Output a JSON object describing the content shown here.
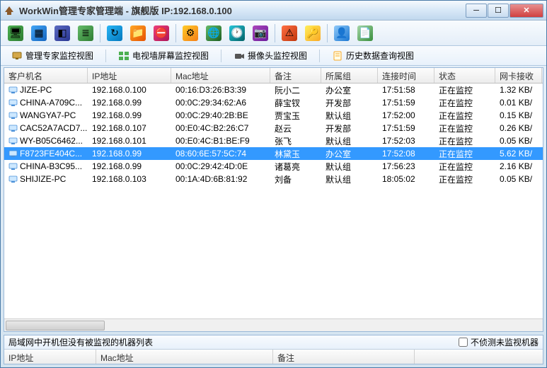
{
  "title": "WorkWin管理专家管理端 - 旗舰版 IP:192.168.0.100",
  "tabs": [
    {
      "label": "管理专家监控视图"
    },
    {
      "label": "电视墙屏幕监控视图"
    },
    {
      "label": "摄像头监控视图"
    },
    {
      "label": "历史数据查询视图"
    }
  ],
  "columns": {
    "client": "客户机名",
    "ip": "IP地址",
    "mac": "Mac地址",
    "remark": "备注",
    "group": "所属组",
    "time": "连接时间",
    "status": "状态",
    "net": "网卡接收"
  },
  "rows": [
    {
      "client": "JIZE-PC",
      "ip": "192.168.0.100",
      "mac": "00:16:D3:26:B3:39",
      "remark": "阮小二",
      "group": "办公室",
      "time": "17:51:58",
      "status": "正在监控",
      "net": "1.32 KB/",
      "selected": false
    },
    {
      "client": "CHINA-A709C...",
      "ip": "192.168.0.99",
      "mac": "00:0C:29:34:62:A6",
      "remark": "薛宝钗",
      "group": "开发部",
      "time": "17:51:59",
      "status": "正在监控",
      "net": "0.01 KB/",
      "selected": false
    },
    {
      "client": "WANGYA7-PC",
      "ip": "192.168.0.99",
      "mac": "00:0C:29:40:2B:BE",
      "remark": "贾宝玉",
      "group": "默认组",
      "time": "17:52:00",
      "status": "正在监控",
      "net": "0.15 KB/",
      "selected": false
    },
    {
      "client": "CAC52A7ACD7...",
      "ip": "192.168.0.107",
      "mac": "00:E0:4C:B2:26:C7",
      "remark": "赵云",
      "group": "开发部",
      "time": "17:51:59",
      "status": "正在监控",
      "net": "0.26 KB/",
      "selected": false
    },
    {
      "client": "WY-B05C6462...",
      "ip": "192.168.0.101",
      "mac": "00:E0:4C:B1:BE:F9",
      "remark": "张飞",
      "group": "默认组",
      "time": "17:52:03",
      "status": "正在监控",
      "net": "0.05 KB/",
      "selected": false
    },
    {
      "client": "F8723FE404C...",
      "ip": "192.168.0.99",
      "mac": "08:60:6E:57:5C:74",
      "remark": "林黛玉",
      "group": "办公室",
      "time": "17:52:08",
      "status": "正在监控",
      "net": "5.62 KB/",
      "selected": true
    },
    {
      "client": "CHINA-B3C95...",
      "ip": "192.168.0.99",
      "mac": "00:0C:29:42:4D:0E",
      "remark": "诸葛亮",
      "group": "默认组",
      "time": "17:56:23",
      "status": "正在监控",
      "net": "2.16 KB/",
      "selected": false
    },
    {
      "client": "SHIJIZE-PC",
      "ip": "192.168.0.103",
      "mac": "00:1A:4D:6B:81:92",
      "remark": "刘备",
      "group": "默认组",
      "time": "18:05:02",
      "status": "正在监控",
      "net": "0.05 KB/",
      "selected": false
    }
  ],
  "bottomPanel": {
    "title": "局域网中开机但没有被监视的机器列表",
    "checkbox": "不侦测未监视机器",
    "cols": {
      "ip": "IP地址",
      "mac": "Mac地址",
      "remark": "备注"
    }
  }
}
